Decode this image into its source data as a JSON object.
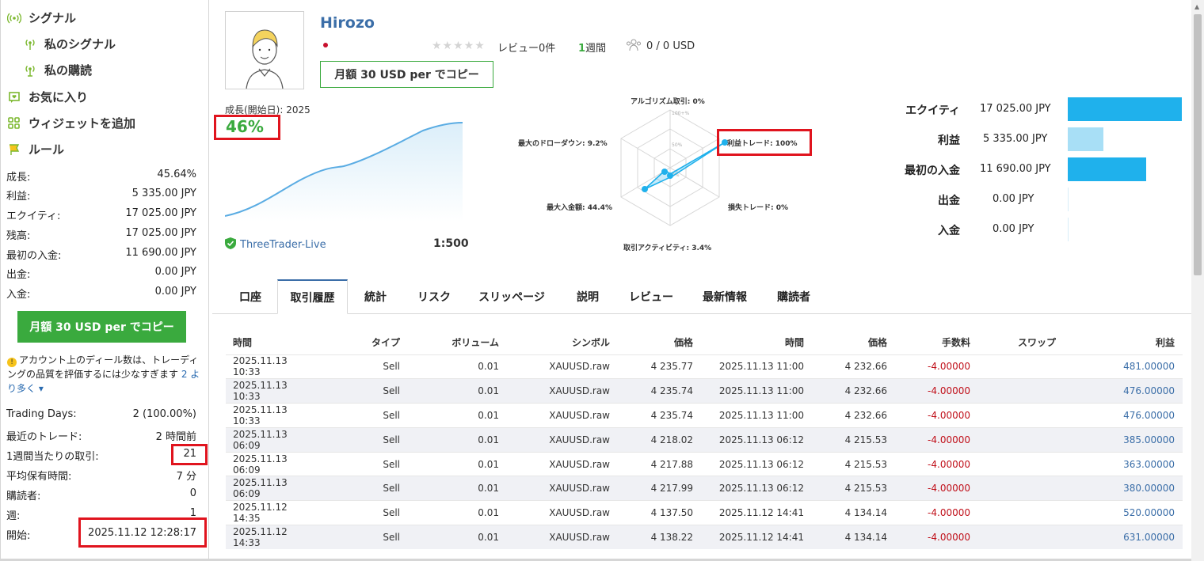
{
  "sidebar": {
    "nav": [
      {
        "label": "シグナル",
        "icon": "signal-icon"
      },
      {
        "label": "私のシグナル",
        "icon": "signal-icon"
      },
      {
        "label": "私の購読",
        "icon": "signal-icon"
      },
      {
        "label": "お気に入り",
        "icon": "favorite-icon"
      },
      {
        "label": "ウィジェットを追加",
        "icon": "widget-icon"
      },
      {
        "label": "ルール",
        "icon": "rules-icon"
      }
    ],
    "stats": [
      {
        "label": "成長:",
        "value": "45.64%"
      },
      {
        "label": "利益:",
        "value": "5 335.00 JPY"
      },
      {
        "label": "エクイティ:",
        "value": "17 025.00 JPY"
      },
      {
        "label": "残高:",
        "value": "17 025.00 JPY"
      },
      {
        "label": "最初の入金:",
        "value": "11 690.00 JPY"
      },
      {
        "label": "出金:",
        "value": "0.00 JPY"
      },
      {
        "label": "入金:",
        "value": "0.00 JPY"
      }
    ],
    "copy_button": "月額 30 USD per でコピー",
    "warning_text": "アカウント上のディール数は、トレーディングの品質を評価するには少なすぎます",
    "warning_link": "2 より多く",
    "stats2": [
      {
        "label": "Trading Days:",
        "value": "2 (100.00%)"
      },
      {
        "label": "最近のトレード:",
        "value": "2 時間前"
      },
      {
        "label": "1週間当たりの取引:",
        "value": "21"
      },
      {
        "label": "平均保有時間:",
        "value": "7 分"
      },
      {
        "label": "購読者:",
        "value": "0"
      },
      {
        "label": "週:",
        "value": "1"
      },
      {
        "label": "開始:",
        "value": "2025.11.12 12:28:17"
      }
    ]
  },
  "profile": {
    "name": "Hirozo",
    "reviews": "レビュー0件",
    "weeks_num": "1",
    "weeks_label": "週間",
    "subscribers": "0 / 0 USD",
    "copy_button": "月額 30 USD per でコピー",
    "rating_stars": 0
  },
  "growth": {
    "label": "成長(開始日):",
    "year": "2025",
    "value": "46%",
    "broker": "ThreeTrader-Live",
    "leverage": "1:500"
  },
  "radar": {
    "labels": {
      "algo": "アルゴリズム取引: 0%",
      "profit_trades": "利益トレード: 100%",
      "loss_trades": "損失トレード: 0%",
      "activity": "取引アクティビティ: 3.4%",
      "max_deposit": "最大入金額: 44.4%",
      "max_drawdown": "最大のドローダウン: 9.2%"
    },
    "scale": [
      "100+%",
      "50%",
      "0%"
    ]
  },
  "bars": [
    {
      "label": "エクイティ",
      "value": "17 025.00 JPY",
      "amount": 17025,
      "color": "#1fb1ec"
    },
    {
      "label": "利益",
      "value": "5 335.00 JPY",
      "amount": 5335,
      "color": "#a8dff6"
    },
    {
      "label": "最初の入金",
      "value": "11 690.00 JPY",
      "amount": 11690,
      "color": "#1fb1ec"
    },
    {
      "label": "出金",
      "value": "0.00 JPY",
      "amount": 0,
      "color": "#a8dff6"
    },
    {
      "label": "入金",
      "value": "0.00 JPY",
      "amount": 0,
      "color": "#a8dff6"
    }
  ],
  "tabs": [
    "口座",
    "取引履歴",
    "統計",
    "リスク",
    "スリッページ",
    "説明",
    "レビュー",
    "最新情報",
    "購読者"
  ],
  "active_tab": 1,
  "table": {
    "headers": [
      "時間",
      "タイプ",
      "ボリューム",
      "シンボル",
      "価格",
      "時間",
      "価格",
      "手数料",
      "スワップ",
      "利益"
    ],
    "rows": [
      [
        "2025.11.13 10:33",
        "Sell",
        "0.01",
        "XAUUSD.raw",
        "4 235.77",
        "2025.11.13 11:00",
        "4 232.66",
        "-4.00000",
        "",
        "481.00000"
      ],
      [
        "2025.11.13 10:33",
        "Sell",
        "0.01",
        "XAUUSD.raw",
        "4 235.74",
        "2025.11.13 11:00",
        "4 232.66",
        "-4.00000",
        "",
        "476.00000"
      ],
      [
        "2025.11.13 10:33",
        "Sell",
        "0.01",
        "XAUUSD.raw",
        "4 235.74",
        "2025.11.13 11:00",
        "4 232.66",
        "-4.00000",
        "",
        "476.00000"
      ],
      [
        "2025.11.13 06:09",
        "Sell",
        "0.01",
        "XAUUSD.raw",
        "4 218.02",
        "2025.11.13 06:12",
        "4 215.53",
        "-4.00000",
        "",
        "385.00000"
      ],
      [
        "2025.11.13 06:09",
        "Sell",
        "0.01",
        "XAUUSD.raw",
        "4 217.88",
        "2025.11.13 06:12",
        "4 215.53",
        "-4.00000",
        "",
        "363.00000"
      ],
      [
        "2025.11.13 06:09",
        "Sell",
        "0.01",
        "XAUUSD.raw",
        "4 217.99",
        "2025.11.13 06:12",
        "4 215.53",
        "-4.00000",
        "",
        "380.00000"
      ],
      [
        "2025.11.12 14:35",
        "Sell",
        "0.01",
        "XAUUSD.raw",
        "4 137.50",
        "2025.11.12 14:41",
        "4 134.14",
        "-4.00000",
        "",
        "520.00000"
      ],
      [
        "2025.11.12 14:33",
        "Sell",
        "0.01",
        "XAUUSD.raw",
        "4 138.22",
        "2025.11.12 14:41",
        "4 134.14",
        "-4.00000",
        "",
        "631.00000"
      ]
    ]
  },
  "colors": {
    "accent_green": "#3aaa3e",
    "link_blue": "#3b6ea8",
    "negative_red": "#c0101a",
    "highlight_red": "#e0141e",
    "bar_blue": "#1fb1ec"
  }
}
